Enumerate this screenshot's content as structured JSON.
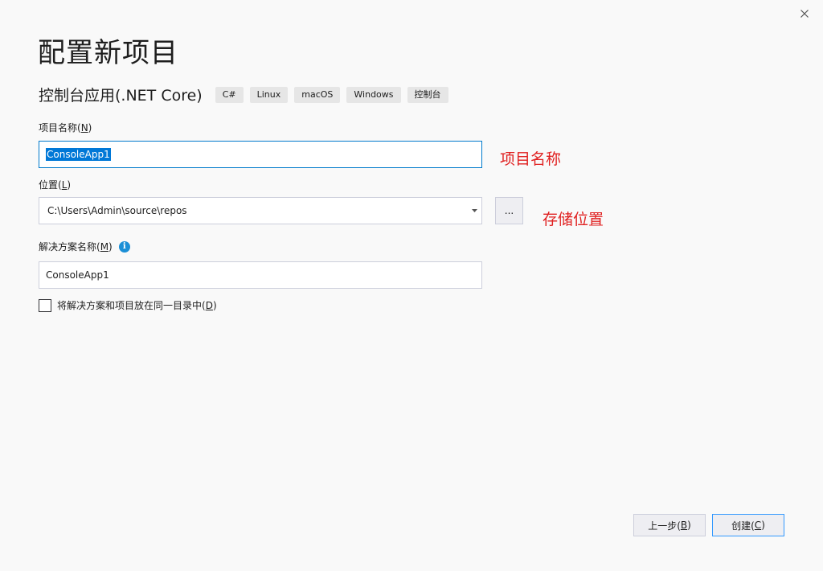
{
  "window": {
    "close_icon": "close-icon"
  },
  "header": {
    "title": "配置新项目"
  },
  "template": {
    "name": "控制台应用(.NET Core)",
    "tags": [
      "C#",
      "Linux",
      "macOS",
      "Windows",
      "控制台"
    ]
  },
  "project_name": {
    "label": "项目名称(",
    "mnemonic": "N",
    "label_end": ")",
    "value": "ConsoleApp1",
    "annotation": "项目名称"
  },
  "location": {
    "label": "位置(",
    "mnemonic": "L",
    "label_end": ")",
    "value": "C:\\Users\\Admin\\source\\repos",
    "browse_label": "...",
    "annotation": "存储位置"
  },
  "solution_name": {
    "label": "解决方案名称(",
    "mnemonic": "M",
    "label_end": ")",
    "value": "ConsoleApp1",
    "info_icon": "info-icon"
  },
  "same_dir": {
    "label": "将解决方案和项目放在同一目录中(",
    "mnemonic": "D",
    "label_end": ")",
    "checked": false
  },
  "buttons": {
    "back": {
      "label": "上一步(",
      "mnemonic": "B",
      "label_end": ")"
    },
    "create": {
      "label": "创建(",
      "mnemonic": "C",
      "label_end": ")"
    }
  },
  "colors": {
    "accent": "#007acc",
    "annotation": "#e02020",
    "selection": "#0078d7"
  }
}
